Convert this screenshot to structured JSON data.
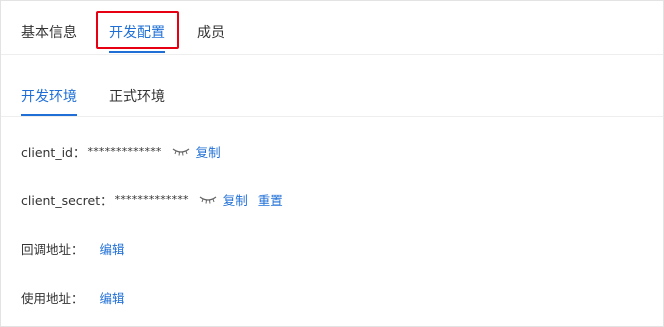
{
  "top_tabs": [
    {
      "label": "基本信息"
    },
    {
      "label": "开发配置",
      "active": true
    },
    {
      "label": "成员"
    }
  ],
  "env_tabs": [
    {
      "label": "开发环境",
      "active": true
    },
    {
      "label": "正式环境"
    }
  ],
  "client_id": {
    "label": "client_id：",
    "masked_value": "*************",
    "toggle_icon": "eye-closed-icon",
    "copy_label": "复制"
  },
  "client_secret": {
    "label": "client_secret：",
    "masked_value": "*************",
    "toggle_icon": "eye-closed-icon",
    "copy_label": "复制",
    "reset_label": "重置"
  },
  "callback_url": {
    "label": "回调地址：",
    "edit_label": "编辑"
  },
  "usage_url": {
    "label": "使用地址：",
    "edit_label": "编辑"
  },
  "colors": {
    "accent": "#1f6fd6",
    "highlight": "#e60012"
  }
}
